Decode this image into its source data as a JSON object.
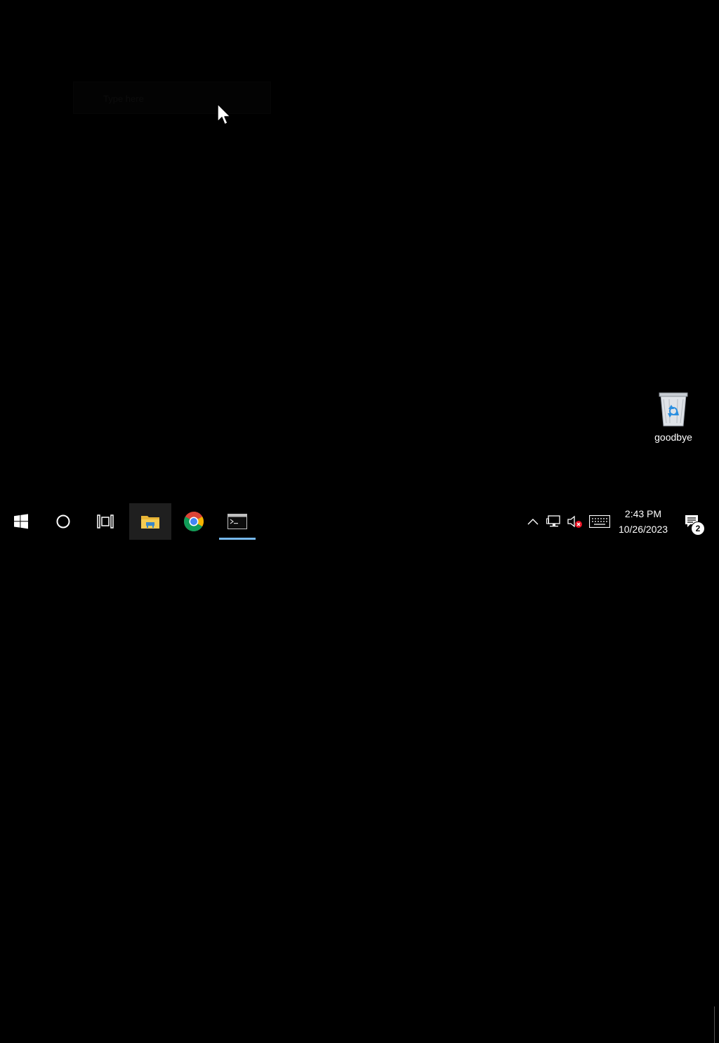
{
  "desktop": {
    "faint_label": "Type here",
    "icons": [
      {
        "name": "recycle-bin",
        "label": "goodbye"
      }
    ]
  },
  "taskbar": {
    "pinned": [
      {
        "name": "start",
        "icon": "windows-logo-icon"
      },
      {
        "name": "search",
        "icon": "cortana-circle-icon"
      },
      {
        "name": "task-view",
        "icon": "task-view-icon"
      },
      {
        "name": "file-explorer",
        "icon": "folder-icon"
      },
      {
        "name": "chrome",
        "icon": "chrome-icon"
      },
      {
        "name": "command-prompt",
        "icon": "terminal-icon"
      }
    ],
    "tray": {
      "clock_time": "2:43 PM",
      "clock_date": "10/26/2023",
      "notification_count": "2"
    }
  },
  "colors": {
    "background": "#000000",
    "active_underline": "#76b9ed",
    "volume_mute_badge": "#e81123"
  }
}
